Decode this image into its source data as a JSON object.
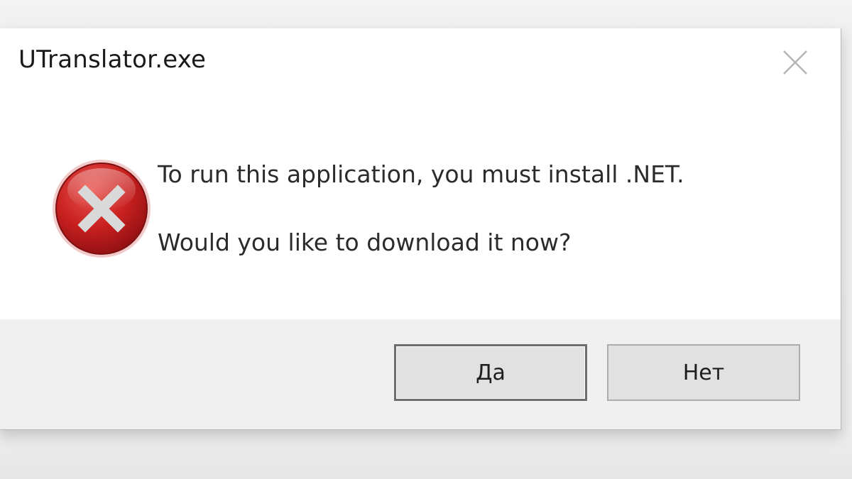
{
  "window": {
    "title": "UTranslator.exe",
    "close_icon": "close-icon"
  },
  "message": {
    "icon": "error-icon",
    "line1": "To run this application, you must install .NET.",
    "line2": "Would you like to download it now?"
  },
  "buttons": {
    "yes_label": "Да",
    "no_label": "Нет"
  },
  "colors": {
    "error_red": "#c81e1e",
    "footer_bg": "#f0f0f0",
    "button_bg": "#e1e1e1"
  }
}
